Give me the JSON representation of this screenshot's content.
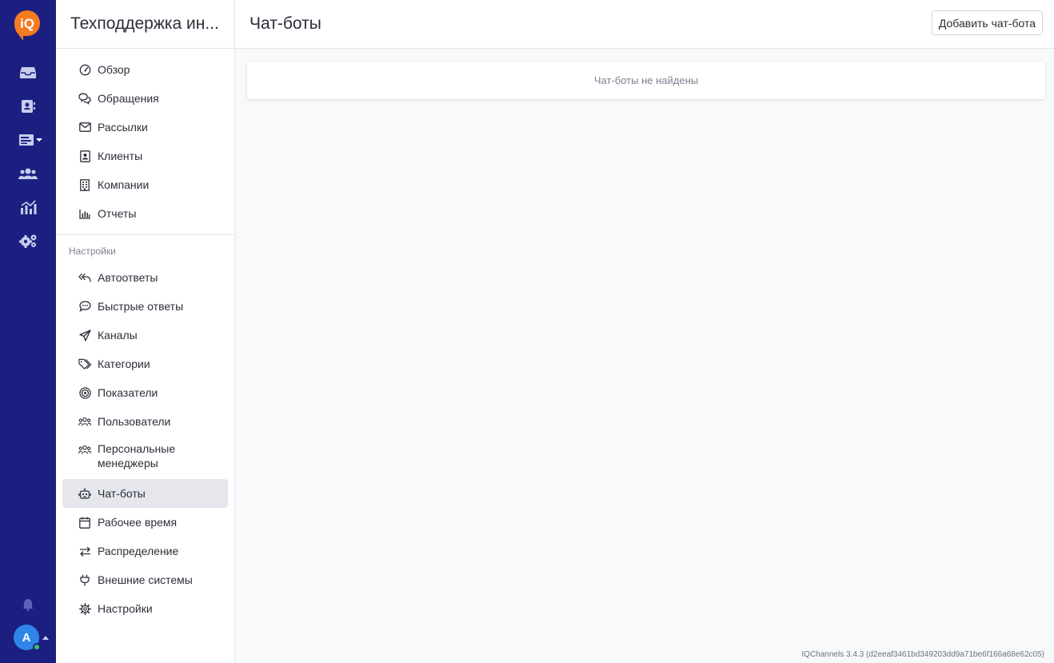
{
  "workspace_title": "Техподдержка ин...",
  "page_title": "Чат-боты",
  "add_button_label": "Добавить чат-бота",
  "empty_message": "Чат-боты не найдены",
  "footer_version": "IQChannels 3.4.3 (d2eeaf3461bd349203dd9a71be6f166a68e62c05)",
  "avatar_initial": "A",
  "logo_text": "iQ",
  "colors": {
    "rail": "#1b2080",
    "accent_orange": "#f47b20",
    "avatar": "#2f86e8",
    "online": "#3cc35c",
    "active_bg": "#e6e7ec"
  },
  "rail_icons": [
    "inbox-icon",
    "contacts-icon",
    "list-icon",
    "users-icon",
    "analytics-icon",
    "settings-icon",
    "bell-icon"
  ],
  "sidebar": {
    "main_items": [
      {
        "label": "Обзор",
        "icon": "gauge-icon"
      },
      {
        "label": "Обращения",
        "icon": "chat-icon"
      },
      {
        "label": "Рассылки",
        "icon": "mail-icon"
      },
      {
        "label": "Клиенты",
        "icon": "contact-card-icon"
      },
      {
        "label": "Компании",
        "icon": "building-icon"
      },
      {
        "label": "Отчеты",
        "icon": "bar-chart-icon"
      }
    ],
    "section_label": "Настройки",
    "settings_items": [
      {
        "label": "Автоответы",
        "icon": "reply-all-icon"
      },
      {
        "label": "Быстрые ответы",
        "icon": "chat-dots-icon"
      },
      {
        "label": "Каналы",
        "icon": "send-icon"
      },
      {
        "label": "Категории",
        "icon": "tags-icon"
      },
      {
        "label": "Показатели",
        "icon": "target-icon"
      },
      {
        "label": "Пользователи",
        "icon": "people-icon"
      },
      {
        "label": "Персональные менеджеры",
        "icon": "people-icon"
      },
      {
        "label": "Чат-боты",
        "icon": "robot-icon",
        "active": true
      },
      {
        "label": "Рабочее время",
        "icon": "calendar-icon"
      },
      {
        "label": "Распределение",
        "icon": "arrows-exchange-icon"
      },
      {
        "label": "Внешние системы",
        "icon": "plug-icon"
      },
      {
        "label": "Настройки",
        "icon": "gear-icon"
      }
    ]
  }
}
